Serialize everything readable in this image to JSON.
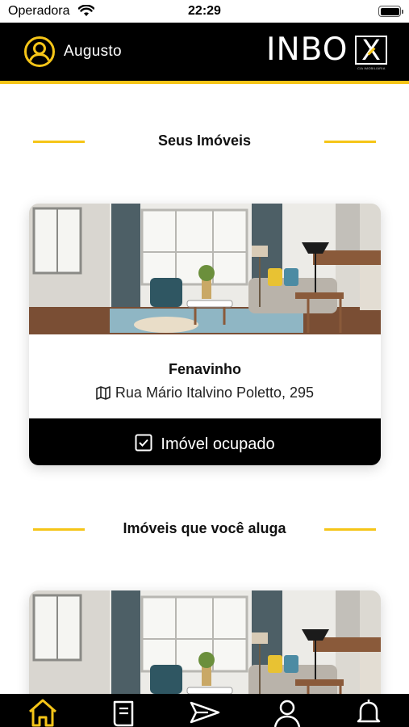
{
  "status_bar": {
    "carrier": "Operadora",
    "time": "22:29"
  },
  "header": {
    "user_name": "Augusto",
    "logo_text": "INBO",
    "logo_x": "X",
    "logo_subtitle": "CIA IMOBILIÁRIA"
  },
  "sections": [
    {
      "title": "Seus Imóveis"
    },
    {
      "title": "Imóveis que você aluga"
    }
  ],
  "properties": [
    {
      "name": "Fenavinho",
      "address": "Rua Mário Italvino Poletto, 295",
      "status": "Imóvel ocupado"
    }
  ],
  "tab_bar": {
    "items": [
      {
        "icon": "home-icon",
        "active": true
      },
      {
        "icon": "receipt-icon",
        "active": false
      },
      {
        "icon": "send-icon",
        "active": false
      },
      {
        "icon": "user-icon",
        "active": false
      },
      {
        "icon": "bell-icon",
        "active": false
      }
    ]
  },
  "colors": {
    "accent": "#f5c518",
    "header_bg": "#000000",
    "card_footer_bg": "#000000"
  }
}
